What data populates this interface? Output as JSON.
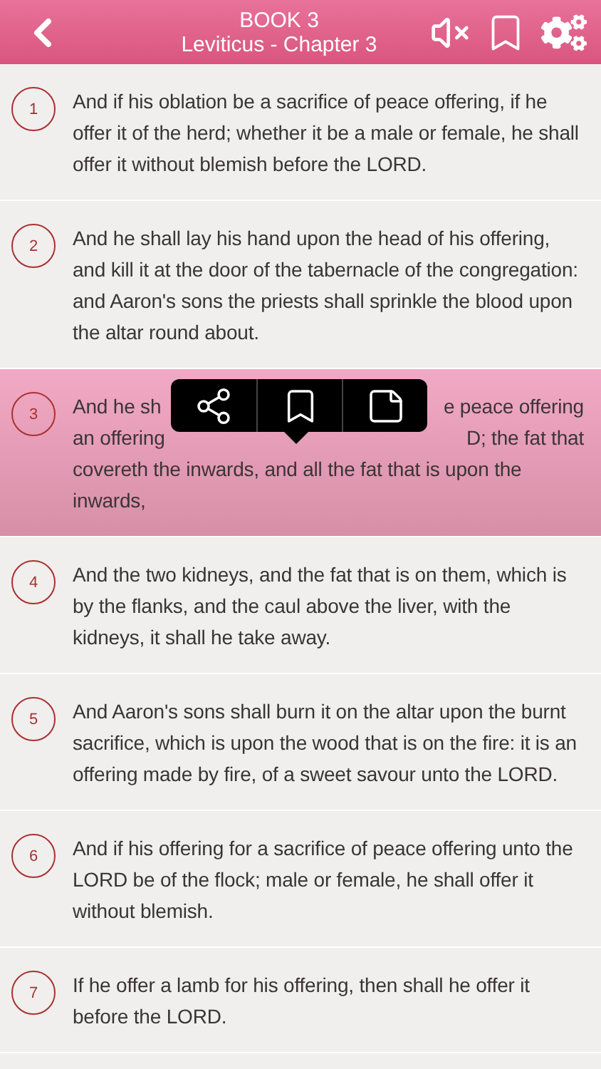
{
  "header": {
    "title": "BOOK 3",
    "subtitle": "Leviticus - Chapter 3",
    "muted": true
  },
  "verses": [
    {
      "number": "1",
      "selected": false,
      "text": "And if his oblation be a sacrifice of peace offering, if he offer it of the herd; whether it be a male or female, he shall offer it without blemish before the LORD."
    },
    {
      "number": "2",
      "selected": false,
      "text": "And he shall lay his hand upon the head of his offering, and kill it at the door of the tabernacle of the congregation: and Aaron's sons the priests shall sprinkle the blood upon the altar round about."
    },
    {
      "number": "3",
      "selected": true,
      "lines": [
        [
          "And he sh",
          "e peace offering"
        ],
        [
          "an offering",
          "D; the fat that"
        ],
        [
          "covereth the inwards, and all the fat that is upon the"
        ],
        [
          "inwards,"
        ]
      ]
    },
    {
      "number": "4",
      "selected": false,
      "text": "And the two kidneys, and the fat that is on them, which is by the flanks, and the caul above the liver, with the kidneys, it shall he take away."
    },
    {
      "number": "5",
      "selected": false,
      "text": "And Aaron's sons shall burn it on the altar upon the burnt sacrifice, which is upon the wood that is on the fire: it is an offering made by fire, of a sweet savour unto the LORD."
    },
    {
      "number": "6",
      "selected": false,
      "text": "And if his offering for a sacrifice of peace offering unto the LORD be of the flock; male or female, he shall offer it without blemish."
    },
    {
      "number": "7",
      "selected": false,
      "text": "If he offer a lamb for his offering, then shall he offer it before the LORD."
    }
  ]
}
